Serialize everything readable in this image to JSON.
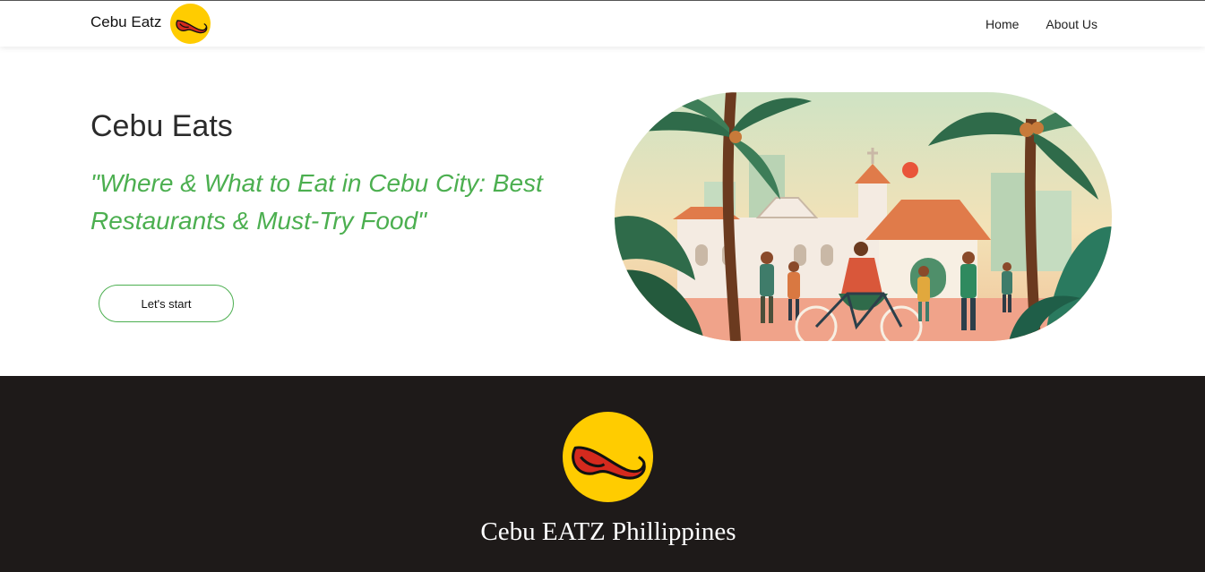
{
  "navbar": {
    "brand_name": "Cebu Eatz",
    "links": [
      {
        "label": "Home"
      },
      {
        "label": "About Us"
      }
    ]
  },
  "hero": {
    "title": "Cebu Eats",
    "tagline": "\"Where & What to Eat in Cebu City: Best Restaurants & Must-Try Food\"",
    "cta_label": "Let's start",
    "image_icon": "cebu-city-illustration"
  },
  "footer": {
    "title": "Cebu EATZ Phillippines",
    "logo_icon": "tongue-logo-icon"
  },
  "colors": {
    "accent_green": "#4caf50",
    "logo_yellow": "#ffcc00",
    "logo_red": "#d42a1e",
    "footer_bg": "#1e1a19"
  }
}
